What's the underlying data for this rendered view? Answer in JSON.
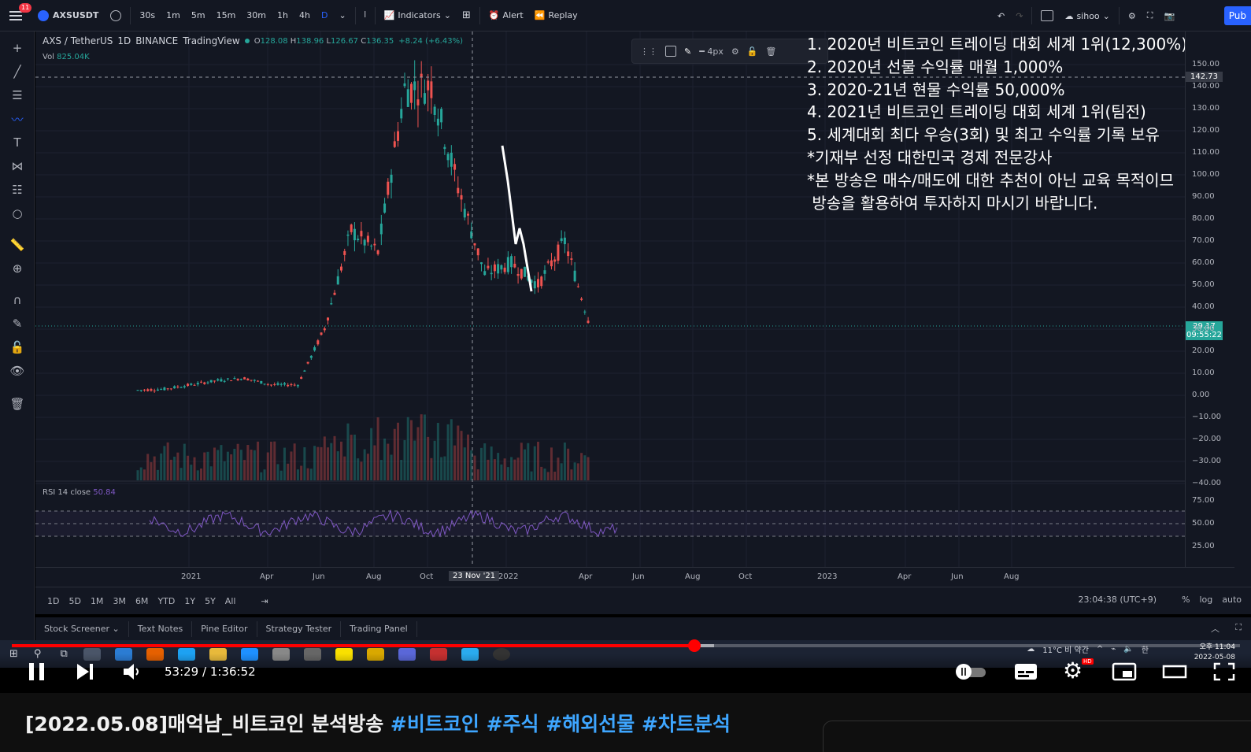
{
  "topbar": {
    "badge": "11",
    "symbol": "AXSUSDT",
    "intervals": [
      "30s",
      "1m",
      "5m",
      "15m",
      "30m",
      "1h",
      "4h",
      "D"
    ],
    "active_interval": "D",
    "indicators": "Indicators",
    "alert": "Alert",
    "replay": "Replay",
    "user": "sihoo",
    "publish": "Pub"
  },
  "legend": {
    "title": "AXS / TetherUS",
    "interval": "1D",
    "exchange": "BINANCE",
    "source": "TradingView",
    "open": "128.08",
    "high": "138.96",
    "low": "126.67",
    "close": "136.35",
    "change": "+8.24 (+6.43%)",
    "vol_label": "Vol",
    "vol_value": "825.04K",
    "rsi_label": "RSI 14 close",
    "rsi_value": "50.84"
  },
  "drawbar": {
    "width_label": "4px"
  },
  "overlay_lines": [
    "1. 2020년 비트코인 트레이딩 대회 세계 1위(12,300%)",
    "2. 2020년 선물 수익률 매월 1,000%",
    "3. 2020-21년 현물 수익률 50,000%",
    "4. 2021년 비트코인 트레이딩 대회 세계 1위(팀전)",
    "5. 세계대회 최다 우승(3회) 및 최고 수익률 기록 보유",
    "*기재부 선정 대한민국 경제 전문강사",
    "*본 방송은 매수/매도에 대한 추천이 아닌 교육 목적이므",
    " 방송을 활용하여 투자하지 마시기 바랍니다."
  ],
  "price_axis": {
    "labels": [
      "150.00",
      "140.00",
      "130.00",
      "120.00",
      "110.00",
      "100.00",
      "90.00",
      "80.00",
      "70.00",
      "60.00",
      "50.00",
      "40.00",
      "30.00",
      "20.00",
      "10.00",
      "0.00",
      "−10.00",
      "−20.00",
      "−30.00",
      "−40.00"
    ],
    "rsi_labels": [
      "75.00",
      "50.00",
      "25.00"
    ],
    "crosshair_price": "142.73",
    "last_price": "29.17",
    "countdown": "09:55:22"
  },
  "time_axis": {
    "labels": [
      "2021",
      "Apr",
      "Jun",
      "Aug",
      "Oct",
      "2022",
      "Apr",
      "Jun",
      "Aug",
      "Oct",
      "2023",
      "Apr",
      "Jun",
      "Aug"
    ],
    "cursor_date": "23 Nov '21"
  },
  "range_bar": {
    "ranges": [
      "1D",
      "5D",
      "1M",
      "3M",
      "6M",
      "YTD",
      "1Y",
      "5Y",
      "All"
    ],
    "clock": "23:04:38 (UTC+9)",
    "percent": "%",
    "log": "log",
    "auto": "auto"
  },
  "panel_tabs": [
    "Stock Screener",
    "Text Notes",
    "Pine Editor",
    "Strategy Tester",
    "Trading Panel"
  ],
  "taskbar": {
    "weather": "11°C 비 약간",
    "ime": "한",
    "time": "오후 11:04",
    "date": "2022-05-08"
  },
  "player": {
    "current_time": "53:29",
    "duration": "1:36:52",
    "time_sep": " / ",
    "progress": 0.556
  },
  "video": {
    "title_main": "[2022.05.08]매억남_비트코인 분석방송 ",
    "hashtags": [
      "#비트코인",
      "#주식",
      "#해외선물",
      "#차트분석"
    ]
  },
  "colors": {
    "up": "#26a69a",
    "down": "#ef5350",
    "rsi": "#7e57c2",
    "accent": "#2962ff",
    "yt_red": "#ff0000"
  },
  "chart_data": {
    "type": "candlestick",
    "series_name": "AXS / TetherUS 1D",
    "x_unit": "month",
    "points": [
      {
        "date": "2020-12",
        "close": 1.5
      },
      {
        "date": "2021-01",
        "close": 2
      },
      {
        "date": "2021-02",
        "close": 4
      },
      {
        "date": "2021-03",
        "close": 6
      },
      {
        "date": "2021-04",
        "close": 7
      },
      {
        "date": "2021-05",
        "close": 4
      },
      {
        "date": "2021-06",
        "close": 4
      },
      {
        "date": "2021-07",
        "close": 30
      },
      {
        "date": "2021-08",
        "close": 75
      },
      {
        "date": "2021-09",
        "close": 65
      },
      {
        "date": "2021-10",
        "close": 140
      },
      {
        "date": "2021-11",
        "close": 142
      },
      {
        "date": "2021-12",
        "close": 95
      },
      {
        "date": "2022-01",
        "close": 55
      },
      {
        "date": "2022-02",
        "close": 60
      },
      {
        "date": "2022-03",
        "close": 50
      },
      {
        "date": "2022-04",
        "close": 70
      },
      {
        "date": "2022-05",
        "close": 29
      }
    ],
    "ylim": [
      -40,
      155
    ],
    "rsi_levels": [
      70,
      50,
      30
    ]
  }
}
